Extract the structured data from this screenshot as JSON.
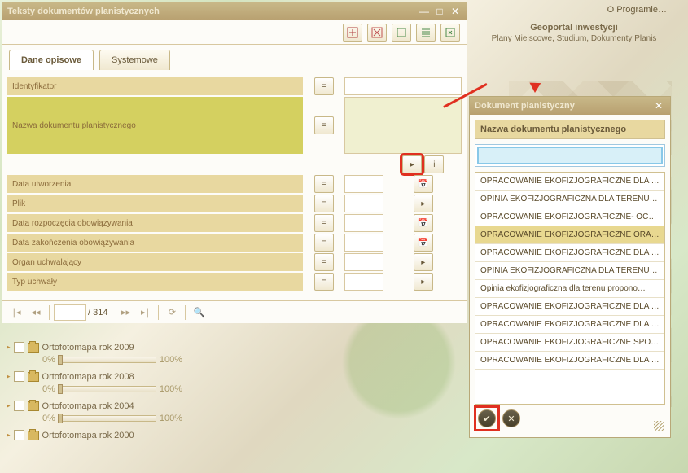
{
  "header": {
    "about": "O Programie…",
    "geo1": "Geoportal inwestycji",
    "geo2": "Plany Miejscowe, Studium, Dokumenty Planis"
  },
  "main": {
    "title": "Teksty dokumentów planistycznych",
    "tabs": {
      "t1": "Dane opisowe",
      "t2": "Systemowe"
    },
    "rows": {
      "r0": "Identyfikator",
      "r1": "Nazwa dokumentu planistycznego",
      "r2": "Data utworzenia",
      "r3": "Plik",
      "r4": "Data rozpoczęcia obowiązywania",
      "r5": "Data zakończenia obowiązywania",
      "r6": "Organ uchwalający",
      "r7": "Typ uchwały"
    },
    "pager": {
      "total": "/ 314"
    }
  },
  "layers": {
    "l0": "Ortofotomapa rok 2009",
    "l1": "Ortofotomapa rok 2008",
    "l2": "Ortofotomapa rok 2004",
    "l3": "Ortofotomapa rok 2000",
    "p0": "0%",
    "p100": "100%"
  },
  "popup": {
    "title": "Dokument planistyczny",
    "label": "Nazwa dokumentu planistycznego",
    "items": {
      "i0": "OPRACOWANIE EKOFIZJOGRAFICZNE DLA …",
      "i1": "OPINIA EKOFIZJOGRAFICZNA DLA TERENU …",
      "i2": "OPRACOWANIE EKOFIZJOGRAFICZNE- OCE…",
      "i3": "OPRACOWANIE EKOFIZJOGRAFICZNE ORA…",
      "i4": "OPRACOWANIE EKOFIZJOGRAFICZNE DLA …",
      "i5": "OPINIA EKOFIZJOGRAFICZNA DLA TERENU …",
      "i6": "Opinia ekofizjograficzna dla terenu propono…",
      "i7": "OPRACOWANIE EKOFIZJOGRAFICZNE DLA …",
      "i8": "OPRACOWANIE EKOFIZJOGRAFICZNE DLA …",
      "i9": "OPRACOWANIE EKOFIZJOGRAFICZNE SPO…",
      "i10": "OPRACOWANIE EKOFIZJOGRAFICZNE DLA …"
    }
  }
}
